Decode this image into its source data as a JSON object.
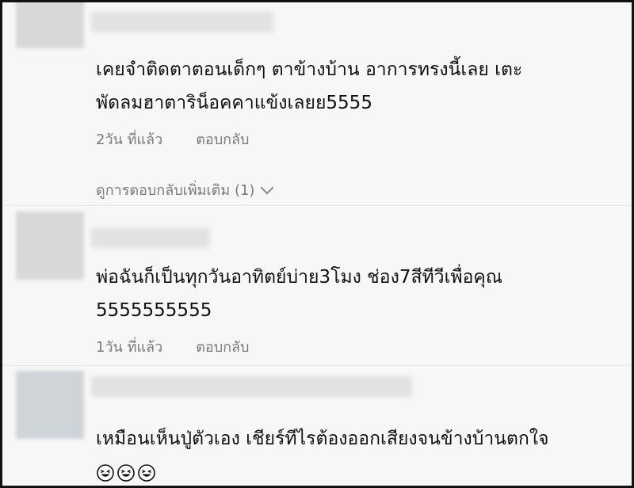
{
  "comments": [
    {
      "text_line1": "เคยจำติดตาตอนเด็กๆ ตาข้างบ้าน อาการทรงนี้เลย เตะ",
      "text_line2": "พัดลมฮาตาริน็อคคาแข้งเลยย5555",
      "time": "2วัน ที่แล้ว",
      "reply": "ตอบกลับ",
      "more_replies": "ดูการตอบกลับเพิ่มเติม (1)"
    },
    {
      "text_line1": "พ่อฉันก็เป็นทุกวันอาทิตย์บ่าย3โมง ช่อง7สีทีวีเพื่อคุณ",
      "text_line2": "5555555555",
      "time": "1วัน ที่แล้ว",
      "reply": "ตอบกลับ"
    },
    {
      "text_line1": "เหมือนเห็นปู่ตัวเอง เชียร์ทีไรต้องออกเสียงจนข้างบ้านตกใจ",
      "emojis": [
        "grinning-squinting-face-icon",
        "grinning-squinting-face-icon",
        "grinning-squinting-face-icon"
      ]
    }
  ]
}
